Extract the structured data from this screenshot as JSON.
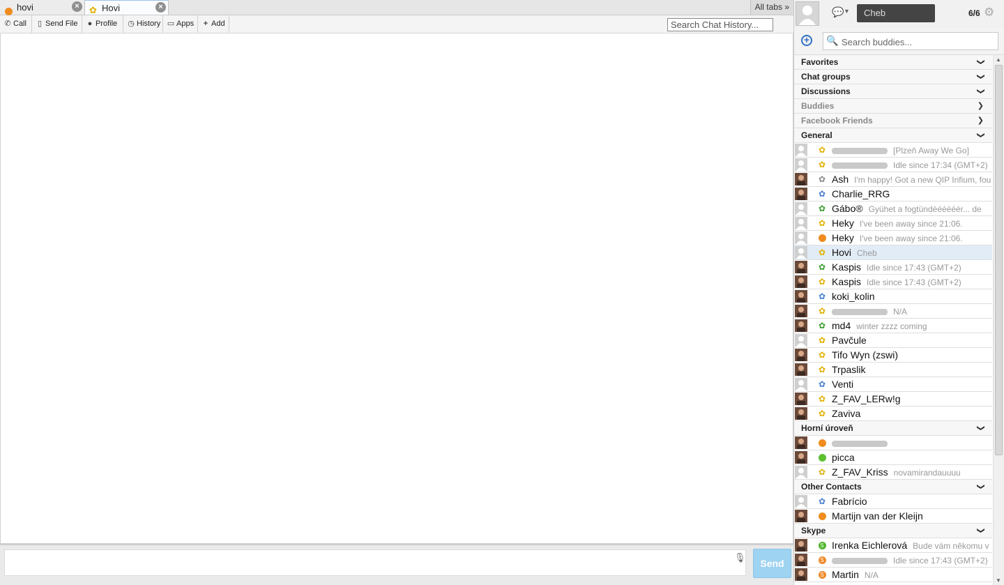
{
  "tabs": [
    {
      "label": "hovi",
      "status": "away"
    },
    {
      "label": "Hovi",
      "status": "online"
    }
  ],
  "all_tabs_label": "All tabs »",
  "toolbar": {
    "call": "Call",
    "send_file": "Send File",
    "profile": "Profile",
    "history": "History",
    "apps": "Apps",
    "add": "Add"
  },
  "history_search": {
    "placeholder": "Search Chat History..."
  },
  "composer": {
    "send_label": "Send"
  },
  "right": {
    "status_text": "Cheb",
    "count": "6/6",
    "search_placeholder": "Search buddies..."
  },
  "groups": [
    {
      "name": "Favorites",
      "expanded": true,
      "muted": false,
      "buddies": []
    },
    {
      "name": "Chat groups",
      "expanded": true,
      "muted": false,
      "buddies": []
    },
    {
      "name": "Discussions",
      "expanded": true,
      "muted": false,
      "buddies": []
    },
    {
      "name": "Buddies",
      "expanded": false,
      "muted": true,
      "buddies": []
    },
    {
      "name": "Facebook Friends",
      "expanded": false,
      "muted": true,
      "buddies": []
    },
    {
      "name": "General",
      "expanded": true,
      "muted": false,
      "buddies": [
        {
          "name": "",
          "msg": "[Plzeň Away We Go]",
          "status": "icq",
          "avatar": "default"
        },
        {
          "name": "",
          "msg": "Idle since 17:34 (GMT+2)",
          "status": "icq",
          "avatar": "default"
        },
        {
          "name": "Ash",
          "msg": "I'm happy! Got a new QIP Infium, fou",
          "status": "icq-grey",
          "avatar": "photo"
        },
        {
          "name": "Charlie_RRG",
          "msg": "",
          "status": "icq-blue",
          "avatar": "photo"
        },
        {
          "name": "Gábo®",
          "msg": "Gyühet a fogtündéééééér... de",
          "status": "icq-green",
          "avatar": "default"
        },
        {
          "name": "Heky",
          "msg": "I've been away since 21:06.",
          "status": "icq",
          "avatar": "default"
        },
        {
          "name": "Heky",
          "msg": "I've been away since 21:06.",
          "status": "away",
          "avatar": "default"
        },
        {
          "name": "Hovi",
          "msg": "Cheb",
          "status": "icq",
          "avatar": "default",
          "selected": true
        },
        {
          "name": "Kaspis",
          "msg": "Idle since 17:43 (GMT+2)",
          "status": "icq-green",
          "avatar": "photo"
        },
        {
          "name": "Kaspis",
          "msg": "Idle since 17:43 (GMT+2)",
          "status": "icq",
          "avatar": "photo"
        },
        {
          "name": "koki_kolin",
          "msg": "",
          "status": "icq-blue",
          "avatar": "photo"
        },
        {
          "name": "",
          "msg": "N/A",
          "status": "icq",
          "avatar": "photo"
        },
        {
          "name": "md4",
          "msg": "winter zzzz coming",
          "status": "icq-green",
          "avatar": "photo"
        },
        {
          "name": "Pavčule",
          "msg": "",
          "status": "icq",
          "avatar": "default"
        },
        {
          "name": "Tifo Wyn (zswi)",
          "msg": "",
          "status": "icq",
          "avatar": "photo"
        },
        {
          "name": "Trpaslik",
          "msg": "",
          "status": "icq",
          "avatar": "photo"
        },
        {
          "name": "Venti",
          "msg": "",
          "status": "icq-blue",
          "avatar": "default"
        },
        {
          "name": "Z_FAV_LERw!g",
          "msg": "",
          "status": "icq",
          "avatar": "photo"
        },
        {
          "name": "Zaviva",
          "msg": "",
          "status": "icq",
          "avatar": "photo"
        }
      ]
    },
    {
      "name": "Horní úroveň",
      "expanded": true,
      "muted": false,
      "buddies": [
        {
          "name": "",
          "msg": "",
          "status": "away",
          "avatar": "photo"
        },
        {
          "name": "picca",
          "msg": "",
          "status": "online-green",
          "avatar": "photo"
        },
        {
          "name": "Z_FAV_Kriss",
          "msg": "novamirandauuuu",
          "status": "icq",
          "avatar": "default"
        }
      ]
    },
    {
      "name": "Other Contacts",
      "expanded": true,
      "muted": false,
      "buddies": [
        {
          "name": "Fabrício",
          "msg": "",
          "status": "icq-blue",
          "avatar": "default"
        },
        {
          "name": "Martijn van der Kleijn",
          "msg": "",
          "status": "away",
          "avatar": "photo"
        }
      ]
    },
    {
      "name": "Skype",
      "expanded": true,
      "muted": false,
      "buddies": [
        {
          "name": "Irenka Eichlerová",
          "msg": "Bude vám někomu v",
          "status": "skype-green",
          "avatar": "photo"
        },
        {
          "name": "",
          "msg": "Idle since 17:43 (GMT+2)",
          "status": "skype-orange",
          "avatar": "photo"
        },
        {
          "name": "Martin",
          "msg": "N/A",
          "status": "skype-orange",
          "avatar": "photo"
        }
      ]
    }
  ],
  "colors": {
    "away": "#f08c1e",
    "online": "#5cc02f",
    "icq_yellow": "#e2b000",
    "icq_blue": "#4a7fd0",
    "icq_green": "#3a9c2e",
    "icq_grey": "#8a8a8a",
    "skype_green": "#4fb52b",
    "skype_orange": "#ee8a2a",
    "send": "#9fd3f2"
  }
}
